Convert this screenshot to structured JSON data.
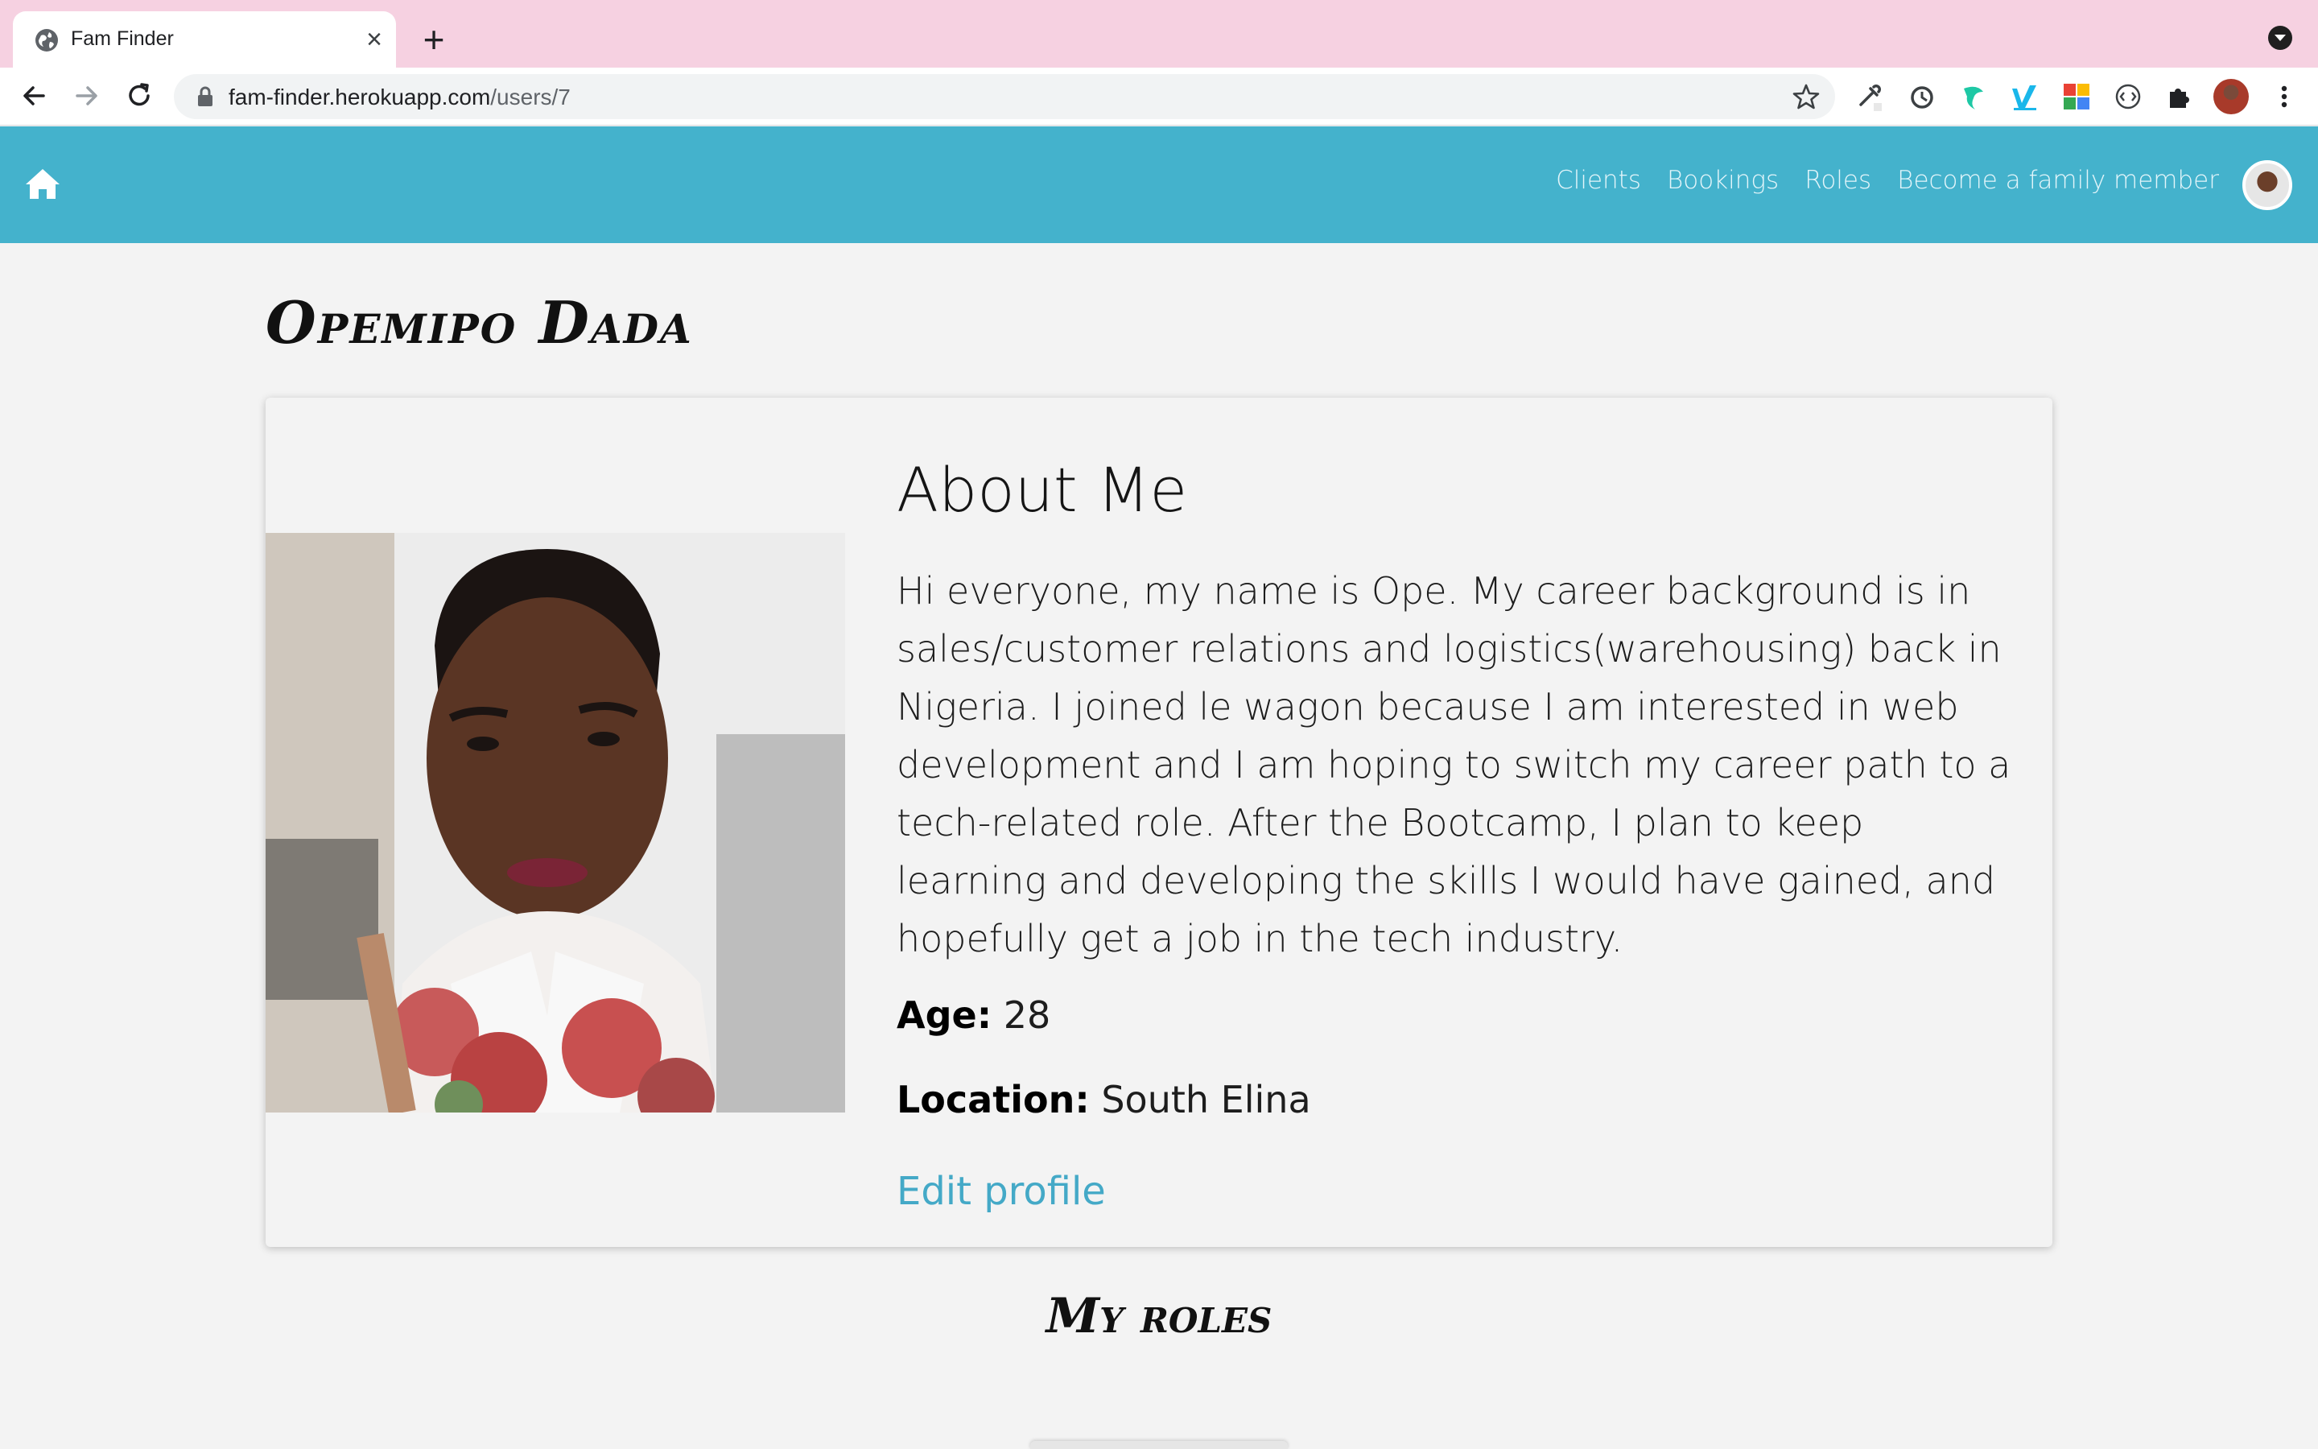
{
  "browser": {
    "tab_title": "Fam Finder",
    "url_domain": "fam-finder.herokuapp.com",
    "url_path": "/users/7",
    "icons": [
      "globe-icon",
      "close-icon",
      "plus-icon",
      "back-icon",
      "forward-icon",
      "reload-icon",
      "lock-icon",
      "star-icon",
      "eyedropper-icon",
      "timer-icon",
      "leaf-icon",
      "vimeo-icon",
      "grid-icon",
      "code-icon",
      "puzzle-icon",
      "kebab-icon"
    ]
  },
  "navbar": {
    "links": [
      "Clients",
      "Bookings",
      "Roles",
      "Become a family member"
    ],
    "color": "#44b2cc"
  },
  "profile": {
    "name": "Opemipo Dada",
    "about_title": "About Me",
    "bio": "Hi everyone, my name is Ope. My career background is in sales/customer relations and logistics(warehousing) back in Nigeria. I joined le wagon because I am interested in web development and I am hoping to switch my career path to a tech-related role. After the Bootcamp, I plan to keep learning and developing the skills I would have gained, and hopefully get a job in the tech industry.",
    "age_label": "Age:",
    "age_value": "28",
    "location_label": "Location:",
    "location_value": "South Elina",
    "edit_link": "Edit profile"
  },
  "roles_section": {
    "title": "My roles"
  }
}
